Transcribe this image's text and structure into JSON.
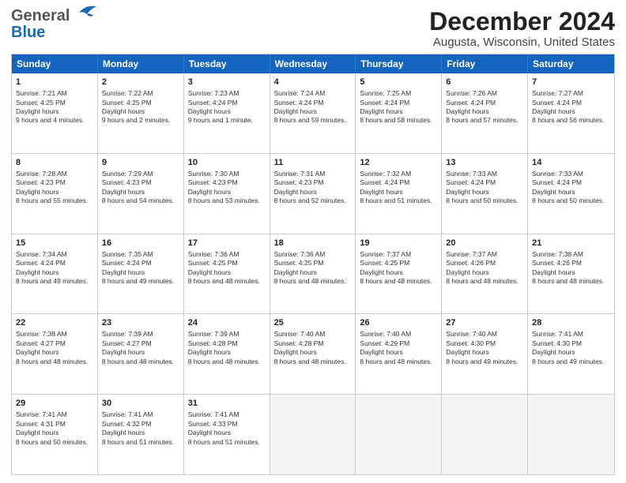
{
  "header": {
    "logo_line1": "General",
    "logo_line2": "Blue",
    "title": "December 2024",
    "subtitle": "Augusta, Wisconsin, United States"
  },
  "days_of_week": [
    "Sunday",
    "Monday",
    "Tuesday",
    "Wednesday",
    "Thursday",
    "Friday",
    "Saturday"
  ],
  "weeks": [
    [
      {
        "day": 1,
        "sun": "7:21 AM",
        "set": "4:25 PM",
        "dl": "9 hours and 4 minutes."
      },
      {
        "day": 2,
        "sun": "7:22 AM",
        "set": "4:25 PM",
        "dl": "9 hours and 2 minutes."
      },
      {
        "day": 3,
        "sun": "7:23 AM",
        "set": "4:24 PM",
        "dl": "9 hours and 1 minute."
      },
      {
        "day": 4,
        "sun": "7:24 AM",
        "set": "4:24 PM",
        "dl": "8 hours and 59 minutes."
      },
      {
        "day": 5,
        "sun": "7:25 AM",
        "set": "4:24 PM",
        "dl": "8 hours and 58 minutes."
      },
      {
        "day": 6,
        "sun": "7:26 AM",
        "set": "4:24 PM",
        "dl": "8 hours and 57 minutes."
      },
      {
        "day": 7,
        "sun": "7:27 AM",
        "set": "4:24 PM",
        "dl": "8 hours and 56 minutes."
      }
    ],
    [
      {
        "day": 8,
        "sun": "7:28 AM",
        "set": "4:23 PM",
        "dl": "8 hours and 55 minutes."
      },
      {
        "day": 9,
        "sun": "7:29 AM",
        "set": "4:23 PM",
        "dl": "8 hours and 54 minutes."
      },
      {
        "day": 10,
        "sun": "7:30 AM",
        "set": "4:23 PM",
        "dl": "8 hours and 53 minutes."
      },
      {
        "day": 11,
        "sun": "7:31 AM",
        "set": "4:23 PM",
        "dl": "8 hours and 52 minutes."
      },
      {
        "day": 12,
        "sun": "7:32 AM",
        "set": "4:24 PM",
        "dl": "8 hours and 51 minutes."
      },
      {
        "day": 13,
        "sun": "7:33 AM",
        "set": "4:24 PM",
        "dl": "8 hours and 50 minutes."
      },
      {
        "day": 14,
        "sun": "7:33 AM",
        "set": "4:24 PM",
        "dl": "8 hours and 50 minutes."
      }
    ],
    [
      {
        "day": 15,
        "sun": "7:34 AM",
        "set": "4:24 PM",
        "dl": "8 hours and 49 minutes."
      },
      {
        "day": 16,
        "sun": "7:35 AM",
        "set": "4:24 PM",
        "dl": "8 hours and 49 minutes."
      },
      {
        "day": 17,
        "sun": "7:36 AM",
        "set": "4:25 PM",
        "dl": "8 hours and 48 minutes."
      },
      {
        "day": 18,
        "sun": "7:36 AM",
        "set": "4:25 PM",
        "dl": "8 hours and 48 minutes."
      },
      {
        "day": 19,
        "sun": "7:37 AM",
        "set": "4:25 PM",
        "dl": "8 hours and 48 minutes."
      },
      {
        "day": 20,
        "sun": "7:37 AM",
        "set": "4:26 PM",
        "dl": "8 hours and 48 minutes."
      },
      {
        "day": 21,
        "sun": "7:38 AM",
        "set": "4:26 PM",
        "dl": "8 hours and 48 minutes."
      }
    ],
    [
      {
        "day": 22,
        "sun": "7:38 AM",
        "set": "4:27 PM",
        "dl": "8 hours and 48 minutes."
      },
      {
        "day": 23,
        "sun": "7:39 AM",
        "set": "4:27 PM",
        "dl": "8 hours and 48 minutes."
      },
      {
        "day": 24,
        "sun": "7:39 AM",
        "set": "4:28 PM",
        "dl": "8 hours and 48 minutes."
      },
      {
        "day": 25,
        "sun": "7:40 AM",
        "set": "4:28 PM",
        "dl": "8 hours and 48 minutes."
      },
      {
        "day": 26,
        "sun": "7:40 AM",
        "set": "4:29 PM",
        "dl": "8 hours and 48 minutes."
      },
      {
        "day": 27,
        "sun": "7:40 AM",
        "set": "4:30 PM",
        "dl": "8 hours and 49 minutes."
      },
      {
        "day": 28,
        "sun": "7:41 AM",
        "set": "4:30 PM",
        "dl": "8 hours and 49 minutes."
      }
    ],
    [
      {
        "day": 29,
        "sun": "7:41 AM",
        "set": "4:31 PM",
        "dl": "8 hours and 50 minutes."
      },
      {
        "day": 30,
        "sun": "7:41 AM",
        "set": "4:32 PM",
        "dl": "8 hours and 51 minutes."
      },
      {
        "day": 31,
        "sun": "7:41 AM",
        "set": "4:33 PM",
        "dl": "8 hours and 51 minutes."
      },
      null,
      null,
      null,
      null
    ]
  ]
}
